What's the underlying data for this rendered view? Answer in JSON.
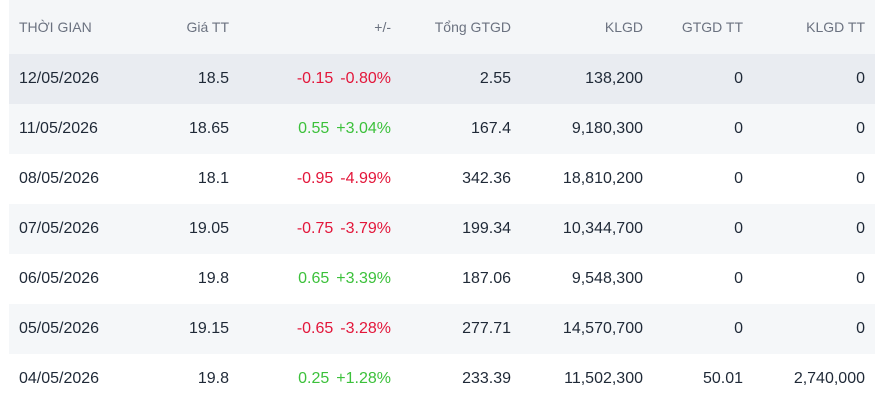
{
  "headers": [
    "THỜI GIAN",
    "Giá TT",
    "+/-",
    "Tổng GTGD",
    "KLGD",
    "GTGD TT",
    "KLGD TT"
  ],
  "rows": [
    {
      "date": "12/05/2026",
      "price": "18.5",
      "change": "-0.15",
      "pct": "-0.80%",
      "dir": "down",
      "total": "2.55",
      "volume": "138,200",
      "neg_value": "0",
      "neg_volume": "0"
    },
    {
      "date": "11/05/2026",
      "price": "18.65",
      "change": "0.55",
      "pct": "+3.04%",
      "dir": "up",
      "total": "167.4",
      "volume": "9,180,300",
      "neg_value": "0",
      "neg_volume": "0"
    },
    {
      "date": "08/05/2026",
      "price": "18.1",
      "change": "-0.95",
      "pct": "-4.99%",
      "dir": "down",
      "total": "342.36",
      "volume": "18,810,200",
      "neg_value": "0",
      "neg_volume": "0"
    },
    {
      "date": "07/05/2026",
      "price": "19.05",
      "change": "-0.75",
      "pct": "-3.79%",
      "dir": "down",
      "total": "199.34",
      "volume": "10,344,700",
      "neg_value": "0",
      "neg_volume": "0"
    },
    {
      "date": "06/05/2026",
      "price": "19.8",
      "change": "0.65",
      "pct": "+3.39%",
      "dir": "up",
      "total": "187.06",
      "volume": "9,548,300",
      "neg_value": "0",
      "neg_volume": "0"
    },
    {
      "date": "05/05/2026",
      "price": "19.15",
      "change": "-0.65",
      "pct": "-3.28%",
      "dir": "down",
      "total": "277.71",
      "volume": "14,570,700",
      "neg_value": "0",
      "neg_volume": "0"
    },
    {
      "date": "04/05/2026",
      "price": "19.8",
      "change": "0.25",
      "pct": "+1.28%",
      "dir": "up",
      "total": "233.39",
      "volume": "11,502,300",
      "neg_value": "50.01",
      "neg_volume": "2,740,000"
    }
  ],
  "colors": {
    "up": "#3cc13b",
    "down": "#e3163a",
    "header_bg": "#f4f6f8",
    "highlight_row_bg": "#e9ecf1"
  }
}
